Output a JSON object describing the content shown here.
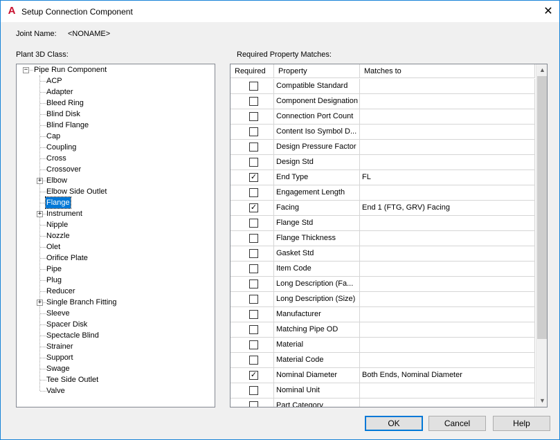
{
  "window": {
    "title": "Setup Connection Component",
    "app_icon": "autocad-a-icon"
  },
  "joint": {
    "label": "Joint Name:",
    "value": "<NONAME>"
  },
  "tree": {
    "label": "Plant 3D Class:",
    "root": "Pipe Run Component",
    "items": [
      {
        "label": "ACP",
        "expandable": false
      },
      {
        "label": "Adapter",
        "expandable": false
      },
      {
        "label": "Bleed Ring",
        "expandable": false
      },
      {
        "label": "Blind Disk",
        "expandable": false
      },
      {
        "label": "Blind Flange",
        "expandable": false
      },
      {
        "label": "Cap",
        "expandable": false
      },
      {
        "label": "Coupling",
        "expandable": false
      },
      {
        "label": "Cross",
        "expandable": false
      },
      {
        "label": "Crossover",
        "expandable": false
      },
      {
        "label": "Elbow",
        "expandable": true
      },
      {
        "label": "Elbow Side Outlet",
        "expandable": false
      },
      {
        "label": "Flange",
        "expandable": false,
        "selected": true
      },
      {
        "label": "Instrument",
        "expandable": true
      },
      {
        "label": "Nipple",
        "expandable": false
      },
      {
        "label": "Nozzle",
        "expandable": false
      },
      {
        "label": "Olet",
        "expandable": false
      },
      {
        "label": "Orifice Plate",
        "expandable": false
      },
      {
        "label": "Pipe",
        "expandable": false
      },
      {
        "label": "Plug",
        "expandable": false
      },
      {
        "label": "Reducer",
        "expandable": false
      },
      {
        "label": "Single Branch Fitting",
        "expandable": true
      },
      {
        "label": "Sleeve",
        "expandable": false
      },
      {
        "label": "Spacer Disk",
        "expandable": false
      },
      {
        "label": "Spectacle Blind",
        "expandable": false
      },
      {
        "label": "Strainer",
        "expandable": false
      },
      {
        "label": "Support",
        "expandable": false
      },
      {
        "label": "Swage",
        "expandable": false
      },
      {
        "label": "Tee Side Outlet",
        "expandable": false
      },
      {
        "label": "Valve",
        "expandable": false
      }
    ]
  },
  "grid": {
    "label": "Required Property Matches:",
    "columns": [
      "Required",
      "Property",
      "Matches to"
    ],
    "rows": [
      {
        "required": false,
        "property": "Compatible Standard",
        "matches": ""
      },
      {
        "required": false,
        "property": "Component Designation",
        "matches": ""
      },
      {
        "required": false,
        "property": "Connection Port Count",
        "matches": ""
      },
      {
        "required": false,
        "property": "Content Iso Symbol D...",
        "matches": ""
      },
      {
        "required": false,
        "property": "Design Pressure Factor",
        "matches": ""
      },
      {
        "required": false,
        "property": "Design Std",
        "matches": ""
      },
      {
        "required": true,
        "property": "End Type",
        "matches": "FL"
      },
      {
        "required": false,
        "property": "Engagement Length",
        "matches": ""
      },
      {
        "required": true,
        "property": "Facing",
        "matches": "End 1 (FTG, GRV) Facing"
      },
      {
        "required": false,
        "property": "Flange Std",
        "matches": ""
      },
      {
        "required": false,
        "property": "Flange Thickness",
        "matches": ""
      },
      {
        "required": false,
        "property": "Gasket Std",
        "matches": ""
      },
      {
        "required": false,
        "property": "Item Code",
        "matches": ""
      },
      {
        "required": false,
        "property": "Long Description (Fa...",
        "matches": ""
      },
      {
        "required": false,
        "property": "Long Description (Size)",
        "matches": ""
      },
      {
        "required": false,
        "property": "Manufacturer",
        "matches": ""
      },
      {
        "required": false,
        "property": "Matching Pipe OD",
        "matches": ""
      },
      {
        "required": false,
        "property": "Material",
        "matches": ""
      },
      {
        "required": false,
        "property": "Material Code",
        "matches": ""
      },
      {
        "required": true,
        "property": "Nominal Diameter",
        "matches": "Both Ends, Nominal Diameter"
      },
      {
        "required": false,
        "property": "Nominal Unit",
        "matches": ""
      },
      {
        "required": false,
        "property": "Part Category",
        "matches": ""
      }
    ]
  },
  "buttons": {
    "ok": "OK",
    "cancel": "Cancel",
    "help": "Help"
  }
}
